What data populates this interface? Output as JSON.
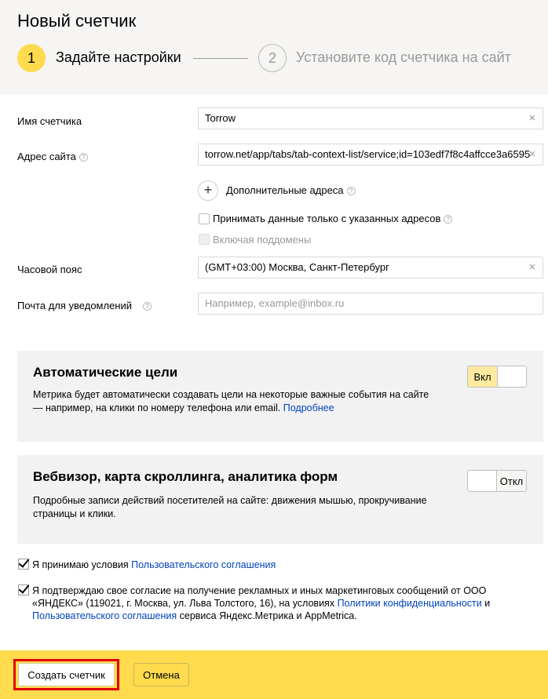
{
  "header": {
    "title": "Новый счетчик",
    "steps": [
      {
        "number": "1",
        "label": "Задайте настройки"
      },
      {
        "number": "2",
        "label": "Установите код счетчика на сайт"
      }
    ]
  },
  "form": {
    "counter_name": {
      "label": "Имя счетчика",
      "value": "Torrow"
    },
    "site_address": {
      "label": "Адрес сайта",
      "value": "torrow.net/app/tabs/tab-context-list/service;id=103edf7f8c4affcce3a6595"
    },
    "additional_addresses": {
      "label": "Дополнительные адреса"
    },
    "only_specified": {
      "label": "Принимать данные только с указанных адресов"
    },
    "include_subdomains": {
      "label": "Включая поддомены"
    },
    "timezone": {
      "label": "Часовой пояс",
      "value": "(GMT+03:00) Москва, Санкт-Петербург"
    },
    "email": {
      "label": "Почта для уведомлений",
      "placeholder": "Например, example@inbox.ru"
    }
  },
  "auto_goals": {
    "title": "Автоматические цели",
    "desc": "Метрика будет автоматически создавать цели на некоторые важные события на сайте — например, на клики по номеру телефона или email.",
    "link": "Подробнее",
    "toggle": "Вкл"
  },
  "webvisor": {
    "title": "Вебвизор, карта скроллинга, аналитика форм",
    "desc": "Подробные записи действий посетителей на сайте: движения мышью, прокручивание страницы и клики.",
    "toggle": "Откл"
  },
  "agree1": {
    "text": "Я принимаю условия",
    "link": "Пользовательского соглашения"
  },
  "agree2": {
    "text1": "Я подтверждаю свое согласие на получение рекламных и иных маркетинговых сообщений от ООО «ЯНДЕКС» (119021, г. Москва, ул. Льва Толстого, 16), на условиях",
    "link1": "Политики конфиденциальности",
    "and": "и",
    "link2": "Пользовательского соглашения",
    "text2": "сервиса Яндекс.Метрика и AppMetrica."
  },
  "footer": {
    "create": "Создать счетчик",
    "cancel": "Отмена"
  },
  "icons": {
    "help": "?",
    "clear": "×",
    "plus": "+"
  },
  "colors": {
    "accent": "#ffdb4d",
    "link": "#0044bb",
    "highlight": "#e00000"
  }
}
